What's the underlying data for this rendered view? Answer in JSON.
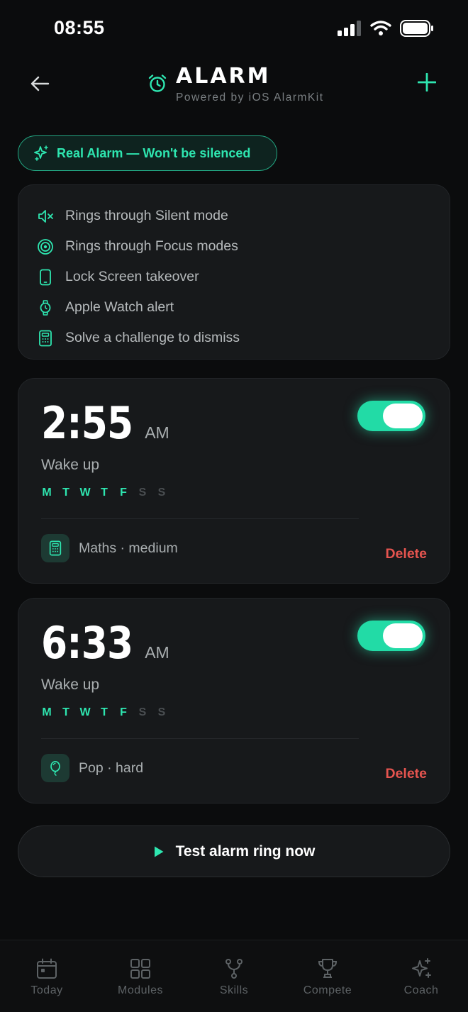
{
  "status_bar": {
    "time": "08:55"
  },
  "header": {
    "title": "ALARM",
    "subtitle": "Powered by iOS AlarmKit"
  },
  "badge": {
    "text": "Real Alarm — Won't be silenced"
  },
  "features": [
    {
      "icon": "speaker-mute-icon",
      "label": "Rings through Silent mode"
    },
    {
      "icon": "target-icon",
      "label": "Rings through Focus modes"
    },
    {
      "icon": "phone-icon",
      "label": "Lock Screen takeover"
    },
    {
      "icon": "watch-icon",
      "label": "Apple Watch alert"
    },
    {
      "icon": "calculator-icon",
      "label": "Solve a challenge to dismiss"
    }
  ],
  "alarms": [
    {
      "time": "2:55",
      "ampm": "AM",
      "label": "Wake up",
      "days": [
        "M",
        "T",
        "W",
        "T",
        "F",
        "S",
        "S"
      ],
      "days_active": [
        true,
        true,
        true,
        true,
        true,
        false,
        false
      ],
      "challenge": "Maths · medium",
      "challenge_icon": "calculator-icon",
      "enabled": true,
      "delete_label": "Delete"
    },
    {
      "time": "6:33",
      "ampm": "AM",
      "label": "Wake up",
      "days": [
        "M",
        "T",
        "W",
        "T",
        "F",
        "S",
        "S"
      ],
      "days_active": [
        true,
        true,
        true,
        true,
        true,
        false,
        false
      ],
      "challenge": "Pop · hard",
      "challenge_icon": "balloon-icon",
      "enabled": true,
      "delete_label": "Delete"
    }
  ],
  "test_button": {
    "label": "Test alarm ring now"
  },
  "tabs": [
    {
      "label": "Today",
      "icon": "calendar-icon"
    },
    {
      "label": "Modules",
      "icon": "grid-icon"
    },
    {
      "label": "Skills",
      "icon": "branch-icon"
    },
    {
      "label": "Compete",
      "icon": "trophy-icon"
    },
    {
      "label": "Coach",
      "icon": "sparkles-icon"
    }
  ],
  "colors": {
    "accent": "#2ee6b0",
    "danger": "#e5544f",
    "background": "#0b0c0d",
    "card": "#17191b"
  }
}
